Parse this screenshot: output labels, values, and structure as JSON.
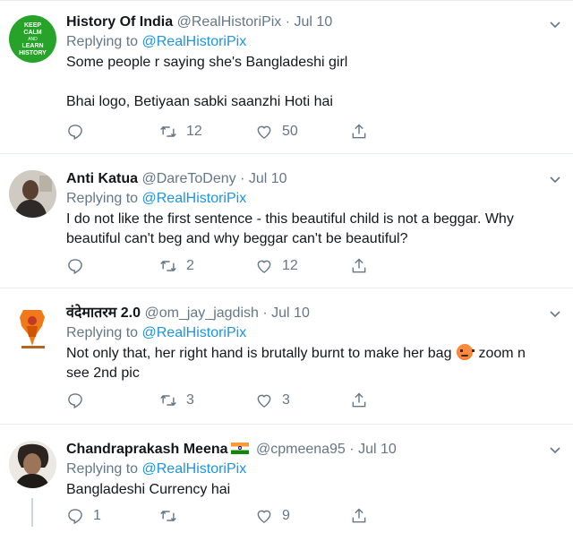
{
  "tweets": [
    {
      "name": "History Of India",
      "handle": "@RealHistoriPix",
      "dot": "·",
      "time": "Jul 10",
      "replying_prefix": "Replying to",
      "replying_to": "@RealHistoriPix",
      "text_1": "Some people r saying she's Bangladeshi girl",
      "text_2": "",
      "text_3": "Bhai logo, Betiyaan sabki saanzhi Hoti hai",
      "avatar": {
        "line1": "KEEP",
        "line2": "CALM",
        "line3": "AND",
        "line4": "LEARN",
        "line5": "HISTORY",
        "color": "#27a32a"
      },
      "reply_count": "",
      "retweet_count": "12",
      "like_count": "50"
    },
    {
      "name": "Anti Katua",
      "handle": "@DareToDeny",
      "dot": "·",
      "time": "Jul 10",
      "replying_prefix": "Replying to",
      "replying_to": "@RealHistoriPix",
      "text_1": "I do not like the first sentence - this beautiful child is not a beggar. Why",
      "text_2": "beautiful can't beg and why beggar can't be beautiful?",
      "reply_count": "",
      "retweet_count": "2",
      "like_count": "12"
    },
    {
      "name": "वंदेमातरम 2.0",
      "handle": "@om_jay_jagdish",
      "dot": "·",
      "time": "Jul 10",
      "replying_prefix": "Replying to",
      "replying_to": "@RealHistoriPix",
      "text_1a": "Not only that, her right hand is brutally burnt to make her bag",
      "text_1b": "zoom n",
      "text_2": "see 2nd pic",
      "reply_count": "",
      "retweet_count": "3",
      "like_count": "3"
    },
    {
      "name": "Chandraprakash Meena",
      "handle": "@cpmeena95",
      "dot": "·",
      "time": "Jul 10",
      "replying_prefix": "Replying to",
      "replying_to": "@RealHistoriPix",
      "text_1": "Bangladeshi Currency hai",
      "reply_count": "1",
      "retweet_count": "",
      "like_count": "9"
    }
  ],
  "colors": {
    "name": "#14171a",
    "muted": "#657786",
    "link": "#1b95e0",
    "border": "#e6ecf0"
  }
}
